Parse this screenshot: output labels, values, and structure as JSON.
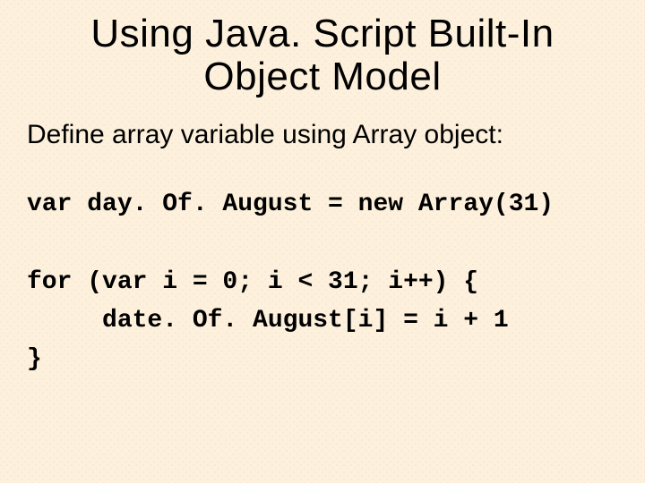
{
  "title_line1": "Using Java. Script Built-In",
  "title_line2": "Object Model",
  "lead": "Define array variable using Array object:",
  "code_l1": "var day. Of. August = new Array(31)",
  "code_l2": "",
  "code_l3": "for (var i = 0; i < 31; i++) {",
  "code_l4": "     date. Of. August[i] = i + 1",
  "code_l5": "}"
}
